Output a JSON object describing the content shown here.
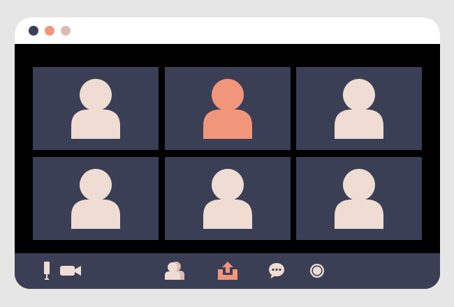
{
  "colors": {
    "page_background": "#e6e6e6",
    "frame": "#000000",
    "titlebar": "#ffffff",
    "tile_background": "#3a3f56",
    "toolbar_background": "#3a3f56",
    "avatar_default": "#efdcd2",
    "avatar_active": "#f1967a",
    "dot_close": "#3a3f56",
    "dot_minimize": "#f1967a",
    "dot_maximize": "#d9bdb4"
  },
  "window": {
    "titlebar": {
      "dots": [
        "dot-dark",
        "dot-orange",
        "dot-pink"
      ]
    }
  },
  "participants": [
    {
      "icon": "person-icon",
      "active": false
    },
    {
      "icon": "person-icon",
      "active": true
    },
    {
      "icon": "person-icon",
      "active": false
    },
    {
      "icon": "person-icon",
      "active": false
    },
    {
      "icon": "person-icon",
      "active": false
    },
    {
      "icon": "person-icon",
      "active": false
    }
  ],
  "toolbar": {
    "items": [
      {
        "icon": "microphone-icon"
      },
      {
        "icon": "video-camera-icon"
      },
      {
        "icon": "participants-icon"
      },
      {
        "icon": "share-screen-icon"
      },
      {
        "icon": "chat-icon"
      },
      {
        "icon": "record-icon"
      }
    ]
  }
}
